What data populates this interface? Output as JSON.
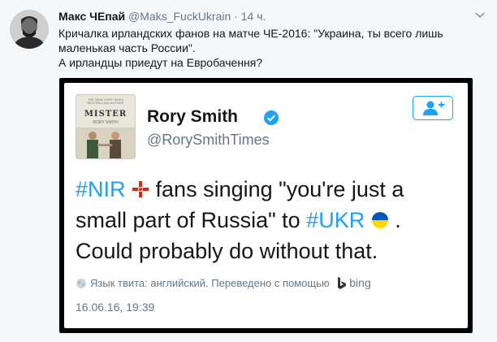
{
  "tweet": {
    "author_name": "Макс ЧЕпай",
    "author_handle": "@Maks_FuckUkrain",
    "separator": "·",
    "time": "14 ч.",
    "text_line1": "Кричалка ирландских фанов на матче ЧЕ-2016: \"Украина, ты всего лишь маленькая часть России\".",
    "text_line2": "А ирландцы приедут на Евробачення?"
  },
  "embedded": {
    "book_small_text": "THE NEW YORK TIMES BESTSELLING AUTHOR",
    "book_title": "MISTER",
    "book_author": "RORY SMITH",
    "name": "Rory Smith",
    "handle": "@RorySmithTimes",
    "text_part1": "#NIR",
    "text_part2": " fans singing \"you're just a small part of Russia\" to ",
    "text_part3": "#UKR",
    "text_part4": " . Could probably do without that.",
    "translate_note": "Язык твита: английский. Переведено с помощью",
    "bing_label": "bing",
    "date": "16.06.16, 19:39"
  },
  "icons": {
    "caret": "chevron-down-icon",
    "verified": "verified-badge-icon",
    "follow": "follow-user-icon",
    "globe": "globe-icon",
    "bing": "bing-logo-icon",
    "flag_nir": "northern-ireland-flag-icon",
    "flag_ukr": "ukraine-flag-icon"
  },
  "colors": {
    "link_blue": "#1da1f2",
    "muted": "#657786",
    "card_border": "#000000",
    "page_bg": "#f5f8fa"
  }
}
